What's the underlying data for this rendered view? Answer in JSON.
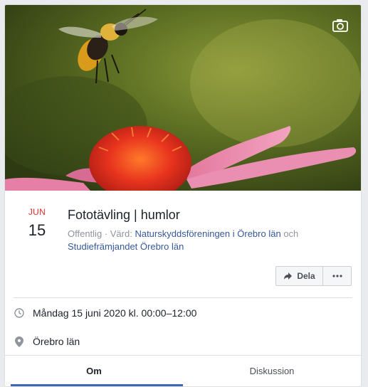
{
  "event": {
    "month": "JUN",
    "day": "15",
    "title": "Fototävling | humlor",
    "privacy": "Offentlig",
    "host_prefix": "· Värd:",
    "host_1": "Naturskyddsföreningen i Örebro län",
    "host_joiner": "och",
    "host_2": "Studiefrämjandet Örebro län",
    "datetime": "Måndag 15 juni 2020 kl. 00:00–12:00",
    "location": "Örebro län"
  },
  "actions": {
    "share_label": "Dela",
    "more_icon": "ellipsis-icon"
  },
  "tabs": [
    {
      "label": "Om"
    },
    {
      "label": "Diskussion"
    }
  ],
  "colors": {
    "month": "#e02b2b",
    "link": "#365899",
    "tab_active": "#4267b2"
  },
  "icons": {
    "cover_camera": "camera-icon",
    "time": "clock-icon",
    "place": "location-pin-icon"
  }
}
